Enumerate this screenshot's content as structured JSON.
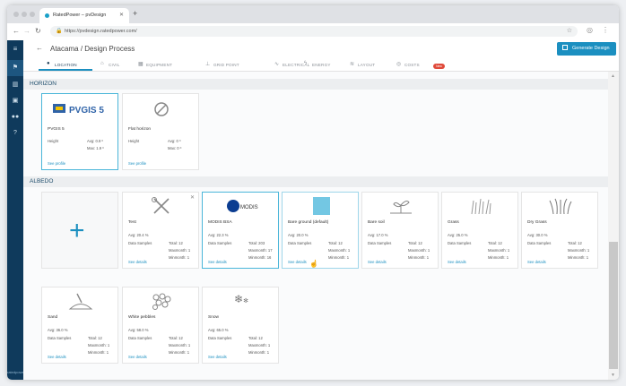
{
  "browser": {
    "tab_title": "RatedPower – pvDesign",
    "url": "https://pvdesign.ratedpower.com/"
  },
  "header": {
    "project": "Atacama",
    "separator": "/",
    "title": "Design Process",
    "generate_label": "Generate Design"
  },
  "tabs": [
    {
      "label": "LOCATION",
      "icon": "pin-icon"
    },
    {
      "label": "CIVIL",
      "icon": "excavator-icon"
    },
    {
      "label": "EQUIPMENT",
      "icon": "panel-icon"
    },
    {
      "label": "GRID POINT",
      "icon": "tower-icon"
    },
    {
      "label": "ELECTRICAL",
      "icon": "wave-icon"
    },
    {
      "label": "ENERGY",
      "icon": "bolt-icon"
    },
    {
      "label": "LAYOUT",
      "icon": "layers-icon"
    },
    {
      "label": "COSTS",
      "icon": "coin-icon"
    }
  ],
  "new_badge": "New",
  "horizon": {
    "title": "HORIZON",
    "cards": [
      {
        "name": "PVGIS 5",
        "logo": "PVGIS 5",
        "height_label": "Height",
        "avg": "Avg: 0.9 º",
        "max": "Max: 1.9 º",
        "see": "See profile"
      },
      {
        "name": "Flat horizon",
        "height_label": "Height",
        "avg": "Avg: 0 º",
        "max": "Max: 0 º",
        "see": "See profile"
      }
    ]
  },
  "albedo": {
    "title": "ALBEDO",
    "cards": [
      {
        "name": "Test",
        "avg": "Avg: 20.4 %",
        "ds": "Data Samples",
        "total": "Total: 12",
        "max": "Maxmonth: 1",
        "min": "Minmonth: 1",
        "see": "See details"
      },
      {
        "name": "MODIS BSA",
        "logo": "MODIS",
        "avg": "Avg: 22.3 %",
        "ds": "Data Samples",
        "total": "Total: 203",
        "max": "Maxmonth: 17",
        "min": "Minmonth: 16",
        "see": "See details"
      },
      {
        "name": "Bare ground (default)",
        "avg": "Avg: 20.0 %",
        "ds": "Data Samples",
        "total": "Total: 12",
        "max": "Maxmonth: 1",
        "min": "Minmonth: 1",
        "see": "See details"
      },
      {
        "name": "Bare soil",
        "avg": "Avg: 17.0 %",
        "ds": "Data Samples",
        "total": "Total: 12",
        "max": "Maxmonth: 1",
        "min": "Minmonth: 1",
        "see": "See details"
      },
      {
        "name": "Grass",
        "avg": "Avg: 25.0 %",
        "ds": "Data Samples",
        "total": "Total: 12",
        "max": "Maxmonth: 1",
        "min": "Minmonth: 1",
        "see": "See details"
      },
      {
        "name": "Dry Grass",
        "avg": "Avg: 30.0 %",
        "ds": "Data Samples",
        "total": "Total: 12",
        "max": "Maxmonth: 1",
        "min": "Minmonth: 1",
        "see": "See details"
      },
      {
        "name": "Sand",
        "avg": "Avg: 36.0 %",
        "ds": "Data Samples",
        "total": "Total: 12",
        "max": "Maxmonth: 1",
        "min": "Minmonth: 1",
        "see": "See details"
      },
      {
        "name": "White pebbles",
        "avg": "Avg: 58.0 %",
        "ds": "Data Samples",
        "total": "Total: 12",
        "max": "Maxmonth: 1",
        "min": "Minmonth: 1",
        "see": "See details"
      },
      {
        "name": "Snow",
        "avg": "Avg: 65.0 %",
        "ds": "Data Samples",
        "total": "Total: 12",
        "max": "Maxmonth: 1",
        "min": "Minmonth: 1",
        "see": "See details"
      }
    ]
  },
  "sidebar_logo": "ratedpower",
  "colors": {
    "accent": "#1b8fc0",
    "sidebar": "#0f3a5c",
    "selected_border": "#4ab6d9",
    "badge": "#e04a3a"
  }
}
